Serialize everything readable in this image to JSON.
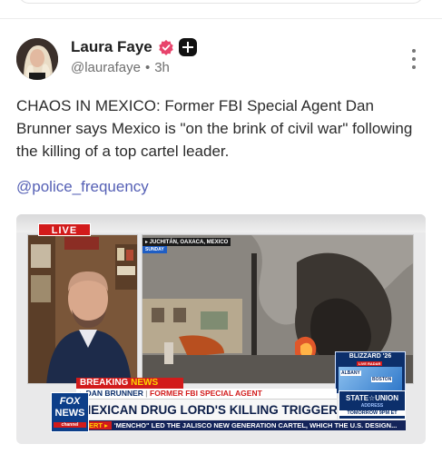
{
  "post": {
    "author_name": "Laura Faye",
    "handle": "@laurafaye",
    "separator": "•",
    "time": "3h",
    "text": "CHAOS IN MEXICO: Former FBI Special Agent Dan Brunner says Mexico is \"on the brink of civil war\" following the killing of a top cartel leader.",
    "mention": "@police_frequency"
  },
  "media": {
    "live_label": "LIVE",
    "location": "▸ JUCHITÁN, OAXACA, MEXICO",
    "location_sub": "SUNDAY",
    "weather_title": "BLIZZARD '26",
    "weather_sub": "LIVE RADAR",
    "city_1": "ALBANY",
    "city_2": "BOSTON",
    "breaking_1": "BREAKING",
    "breaking_2": "NEWS",
    "speaker_name": "▸ DAN BRUNNER",
    "speaker_sep": "|",
    "speaker_role": "FORMER FBI SPECIAL AGENT",
    "headline": "MEXICAN DRUG LORD'S KILLING TRIGGERS CHAOS",
    "logo_fox": "FOX",
    "logo_news": "NEWS",
    "logo_channel": "channel",
    "sotu_title": "STATE☆UNION",
    "sotu_sub": "ADDRESS",
    "sotu_time": "TOMORROW 9PM ET",
    "ticker_alert": "ALERT ▸",
    "ticker_text": "'MENCHO\" LED THE JALISCO NEW GENERATION CARTEL, WHICH THE U.S. DESIGN..."
  },
  "colors": {
    "verified_badge": "#e8446c",
    "mention": "#5560b5",
    "live_red": "#d21b1b",
    "fox_blue": "#0c3e89"
  },
  "icons": [
    "verified-icon",
    "plus-badge-icon",
    "more-options-icon"
  ]
}
